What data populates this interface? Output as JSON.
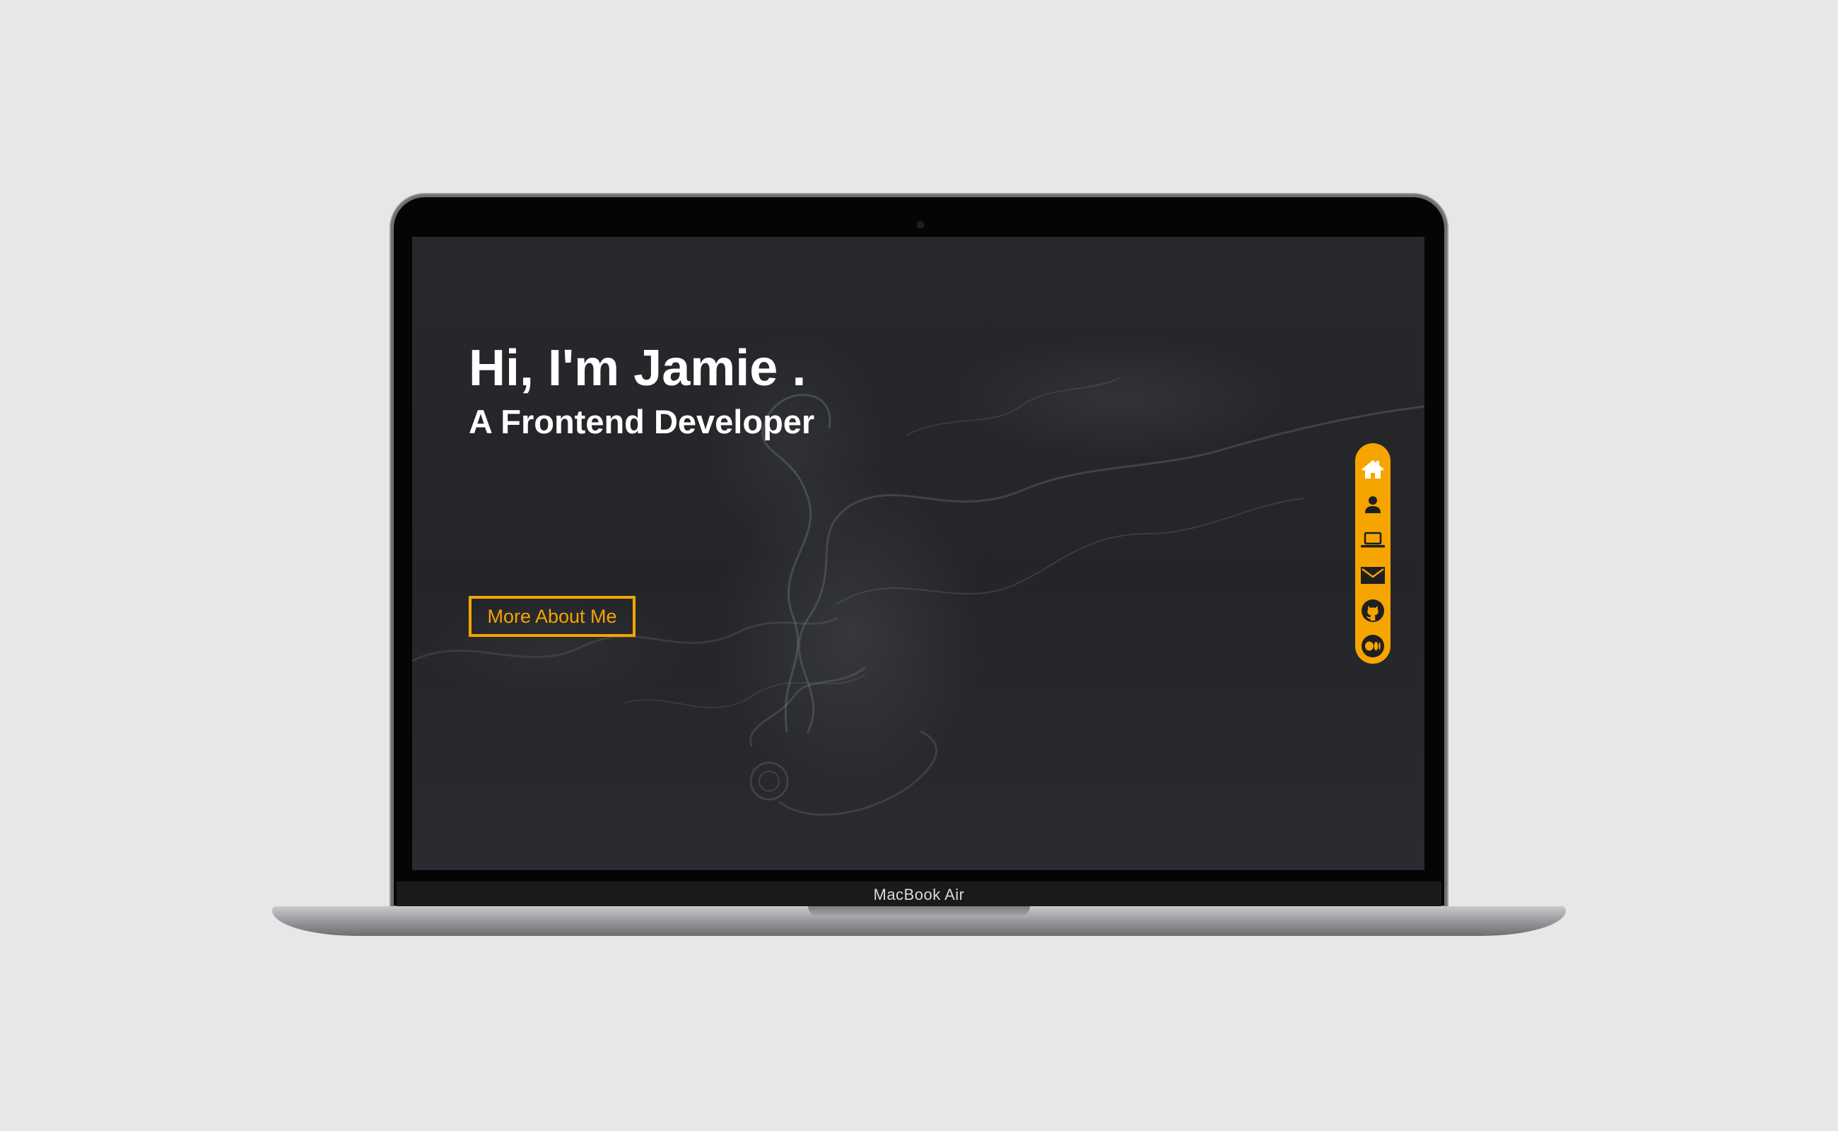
{
  "hero": {
    "title": "Hi, I'm Jamie .",
    "subtitle": "A Frontend Developer",
    "cta_label": "More About Me"
  },
  "device": {
    "label": "MacBook Air"
  },
  "sidenav": {
    "items": [
      {
        "name": "home",
        "icon": "home-icon",
        "active": true
      },
      {
        "name": "about",
        "icon": "user-icon"
      },
      {
        "name": "projects",
        "icon": "laptop-icon"
      },
      {
        "name": "contact",
        "icon": "mail-icon"
      },
      {
        "name": "github",
        "icon": "github-icon"
      },
      {
        "name": "medium",
        "icon": "medium-icon"
      }
    ]
  },
  "colors": {
    "accent": "#f5a400",
    "background": "#e7e7e7",
    "screen": "#26272b",
    "text": "#ffffff"
  }
}
